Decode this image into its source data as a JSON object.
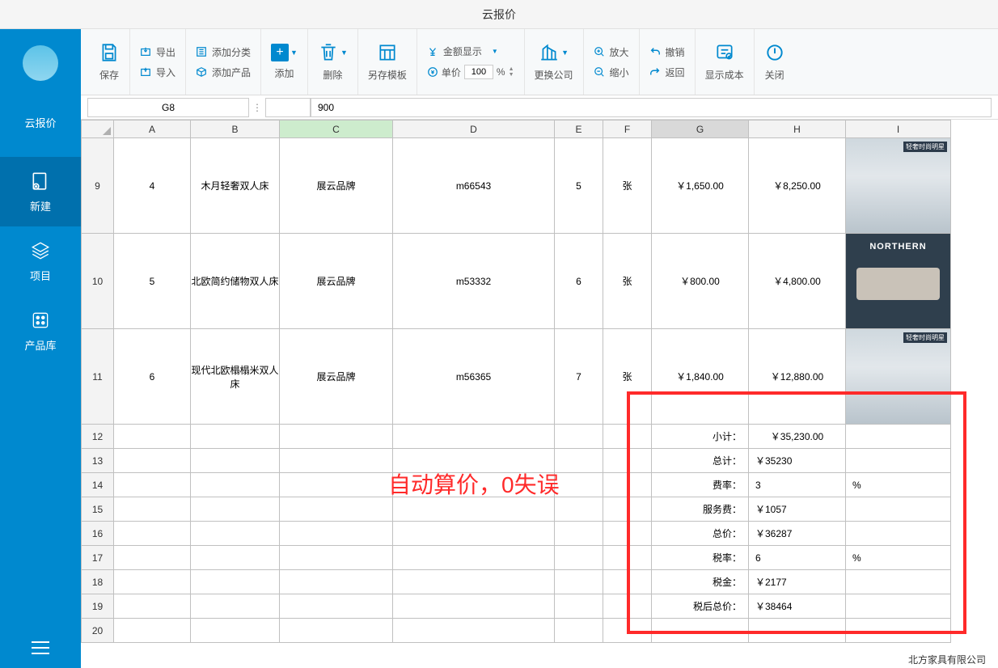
{
  "title": "云报价",
  "leftnav": {
    "items": [
      {
        "label": "云报价",
        "name": "nav-quote"
      },
      {
        "label": "新建",
        "name": "nav-new"
      },
      {
        "label": "项目",
        "name": "nav-project"
      },
      {
        "label": "产品库",
        "name": "nav-products"
      }
    ]
  },
  "toolbar": {
    "save": "保存",
    "export": "导出",
    "import": "导入",
    "addCategory": "添加分类",
    "addProduct": "添加产品",
    "add": "添加",
    "delete": "删除",
    "saveTemplate": "另存模板",
    "amountShow": "金额显示",
    "unitPrice": "单价",
    "unitPriceVal": "100",
    "unitPriceSuffix": "%",
    "switchCompany": "更换公司",
    "zoomIn": "放大",
    "zoomOut": "缩小",
    "undo": "撤销",
    "redo": "返回",
    "showCost": "显示成本",
    "close": "关闭"
  },
  "formula": {
    "cellRef": "G8",
    "value": "900"
  },
  "columns": [
    "A",
    "B",
    "C",
    "D",
    "E",
    "F",
    "G",
    "H",
    "I"
  ],
  "activeCol": "C",
  "selCol": "G",
  "productRows": [
    {
      "rn": "9",
      "idx": "4",
      "name": "木月轻奢双人床",
      "brand": "展云品牌",
      "model": "m66543",
      "qty": "5",
      "unit": "张",
      "price": "￥1,650.00",
      "total": "￥8,250.00",
      "imgTag": "轻奢时尚明星"
    },
    {
      "rn": "10",
      "idx": "5",
      "name": "北欧简约储物双人床",
      "brand": "展云品牌",
      "model": "m53332",
      "qty": "6",
      "unit": "张",
      "price": "￥800.00",
      "total": "￥4,800.00",
      "imgTag": "NORTHERN",
      "northern": true
    },
    {
      "rn": "11",
      "idx": "6",
      "name": "现代北欧榻榻米双人床",
      "brand": "展云品牌",
      "model": "m56365",
      "qty": "7",
      "unit": "张",
      "price": "￥1,840.00",
      "total": "￥12,880.00",
      "imgTag": "轻奢时尚明星"
    }
  ],
  "summary": {
    "subtotal_lab": "小计：",
    "subtotal_val": "￥35,230.00",
    "total_lab": "总计：",
    "total_val": "￥35230",
    "rate_lab": "费率：",
    "rate_val": "3",
    "rate_unit": "%",
    "service_lab": "服务费：",
    "service_val": "￥1057",
    "grand_lab": "总价：",
    "grand_val": "￥36287",
    "taxrate_lab": "税率：",
    "taxrate_val": "6",
    "taxrate_unit": "%",
    "tax_lab": "税金：",
    "tax_val": "￥2177",
    "aftertax_lab": "税后总价：",
    "aftertax_val": "￥38464"
  },
  "sumRowNums": [
    "12",
    "13",
    "14",
    "15",
    "16",
    "17",
    "18",
    "19",
    "20"
  ],
  "annotation": "自动算价，0失误",
  "footerCompany": "北方家具有限公司"
}
